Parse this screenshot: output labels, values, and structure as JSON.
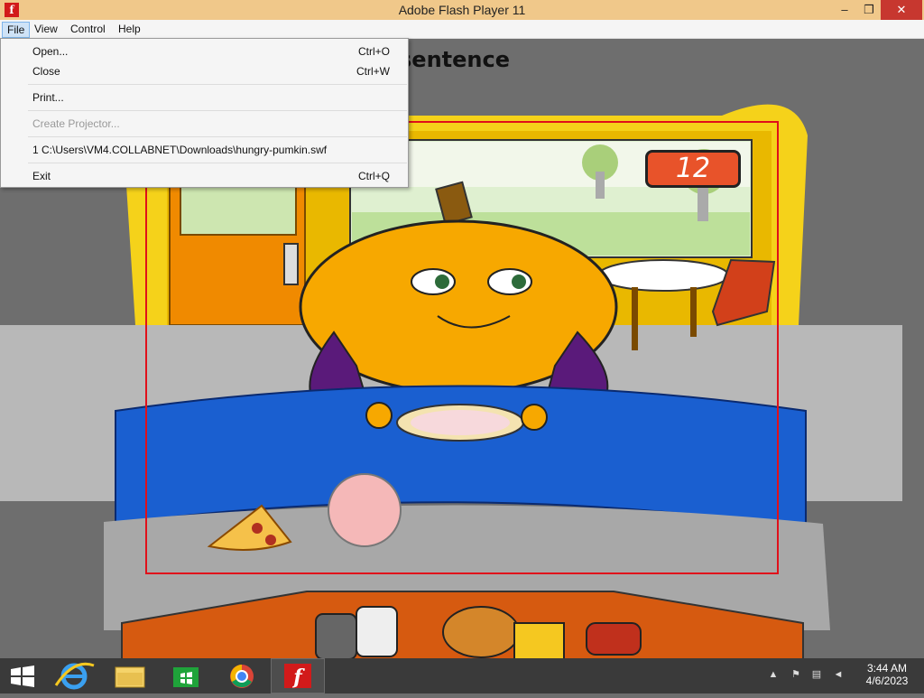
{
  "window": {
    "title": "Adobe Flash Player 11",
    "app_icon_glyph": "f"
  },
  "window_controls": {
    "minimize": "–",
    "maximize": "❐",
    "close": "✕"
  },
  "menubar": {
    "items": [
      "File",
      "View",
      "Control",
      "Help"
    ],
    "active": "File"
  },
  "file_menu": {
    "open": {
      "label": "Open...",
      "shortcut": "Ctrl+O"
    },
    "close": {
      "label": "Close",
      "shortcut": "Ctrl+W"
    },
    "print": {
      "label": "Print..."
    },
    "create_projector": {
      "label": "Create Projector..."
    },
    "recent": {
      "label": "1 C:\\Users\\VM4.COLLABNET\\Downloads\\hungry-pumkin.swf"
    },
    "exit": {
      "label": "Exit",
      "shortcut": "Ctrl+Q"
    }
  },
  "game": {
    "sentence_fragment": "sentence",
    "score": "12"
  },
  "taskbar": {
    "apps": [
      "windows-start-icon",
      "internet-explorer-icon",
      "file-explorer-icon",
      "windows-store-icon",
      "chrome-icon",
      "flash-player-icon"
    ],
    "active_app": "flash-player-icon"
  },
  "tray": {
    "time": "3:44 AM",
    "date": "4/6/2023"
  },
  "colors": {
    "titlebar": "#f0c88a",
    "close_button": "#c7372f",
    "score_box": "#e8532a",
    "stage_border": "#e0101a",
    "pumpkin": "#f7a800",
    "taskbar": "#3a3a3a"
  }
}
